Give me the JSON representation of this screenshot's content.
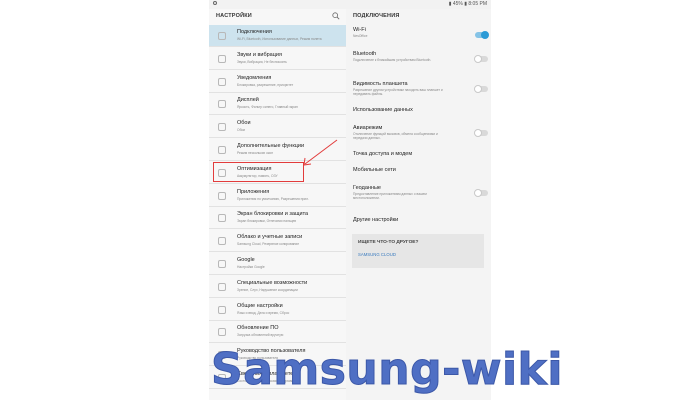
{
  "status_bar": {
    "right_text": "▮ 45% ▮ 8:05 PM"
  },
  "left_pane": {
    "title": "НАСТРОЙКИ",
    "items": [
      {
        "title": "Подключения",
        "subtitle": "Wi-Fi, Bluetooth, Использование данных, Режим полета",
        "icon": "connections-icon",
        "active": true
      },
      {
        "title": "Звуки и вибрация",
        "subtitle": "Звуки, Вибрация, Не беспокоить",
        "icon": "sound-icon"
      },
      {
        "title": "Уведомления",
        "subtitle": "Блокировка, разрешение, приоритет",
        "icon": "notification-icon"
      },
      {
        "title": "Дисплей",
        "subtitle": "Яркость, Фильтр синего, Главный экран",
        "icon": "display-icon"
      },
      {
        "title": "Обои",
        "subtitle": "Обои",
        "icon": "wallpaper-icon"
      },
      {
        "title": "Дополнительные функции",
        "subtitle": "Режим нескольких окон",
        "icon": "advanced-features-icon"
      },
      {
        "title": "Оптимизация",
        "subtitle": "Аккумулятор, память, ОЗУ",
        "icon": "optimization-icon"
      },
      {
        "title": "Приложения",
        "subtitle": "Приложения по умолчанию, Разрешения прил.",
        "icon": "apps-icon"
      },
      {
        "title": "Экран блокировки и защита",
        "subtitle": "Экран блокировки, Отпечатки пальцев",
        "icon": "lock-icon"
      },
      {
        "title": "Облако и учетные записи",
        "subtitle": "Samsung Cloud, Резервное копирование",
        "icon": "cloud-icon"
      },
      {
        "title": "Google",
        "subtitle": "Настройки Google",
        "icon": "google-icon"
      },
      {
        "title": "Специальные возможности",
        "subtitle": "Зрение, Слух, Нарушение координации",
        "icon": "accessibility-icon"
      },
      {
        "title": "Общие настройки",
        "subtitle": "Язык и ввод, Дата и время, Сброс",
        "icon": "general-settings-icon"
      },
      {
        "title": "Обновление ПО",
        "subtitle": "Загрузка обновлений вручную",
        "icon": "software-update-icon"
      },
      {
        "title": "Руководство пользователя",
        "subtitle": "Руководство пользователя",
        "icon": "user-manual-icon"
      },
      {
        "title": "Сведения о планшете",
        "subtitle": "Состояние, Юридическая информация",
        "icon": "about-icon"
      }
    ]
  },
  "right_pane": {
    "title": "ПОДКЛЮЧЕНИЯ",
    "items": [
      {
        "title": "Wi-Fi",
        "subtitle": "NesOffice",
        "toggle": "on"
      },
      {
        "title": "Bluetooth",
        "subtitle": "Подключение к ближайшим устройствам Bluetooth.",
        "toggle": "off"
      },
      {
        "title": "Видимость планшета",
        "subtitle": "Разрешение другим устройствам находить ваш планшет и передавать файлы.",
        "toggle": "off"
      },
      {
        "title": "Использование данных",
        "subtitle": "",
        "toggle": null
      },
      {
        "title": "Авиарежим",
        "subtitle": "Отключение функций вызовов, обмена сообщениями и передачи данных.",
        "toggle": "off"
      },
      {
        "title": "Точка доступа и модем",
        "subtitle": "",
        "toggle": null
      },
      {
        "title": "Мобильные сети",
        "subtitle": "",
        "toggle": null
      },
      {
        "title": "Геоданные",
        "subtitle": "Предоставление приложениям данных о вашем местоположении.",
        "toggle": "off"
      },
      {
        "title": "Другие настройки",
        "subtitle": "",
        "toggle": null
      }
    ],
    "search_prompt": {
      "question": "ИЩЕТЕ ЧТО-ТО ДРУГОЕ?",
      "link": "SAMSUNG CLOUD"
    }
  },
  "watermark": "Samsung-wiki",
  "colors": {
    "active_row": "#cde3ee",
    "highlight": "#e23c3c",
    "toggle_on": "#2b9ad6",
    "watermark": "#4f6fc4"
  }
}
